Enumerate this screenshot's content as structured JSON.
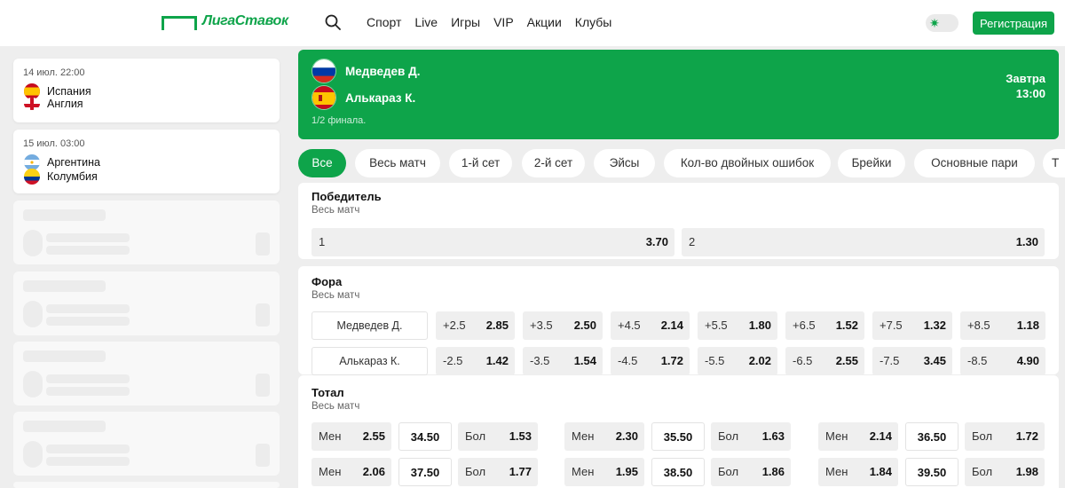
{
  "header": {
    "logo": "ЛигаСтавок",
    "nav": [
      "Спорт",
      "Live",
      "Игры",
      "VIP",
      "Акции",
      "Клубы"
    ],
    "register": "Регистрация"
  },
  "sidebar": {
    "matches": [
      {
        "date": "14 июл. 22:00",
        "team1": "Испания",
        "team2": "Англия"
      },
      {
        "date": "15 июл. 03:00",
        "team1": "Аргентина",
        "team2": "Колумбия"
      }
    ]
  },
  "event": {
    "player1": "Медведев Д.",
    "player2": "Алькараз К.",
    "round": "1/2 финала.",
    "day": "Завтра",
    "time": "13:00"
  },
  "filters": [
    "Все",
    "Весь матч",
    "1-й сет",
    "2-й сет",
    "Эйсы",
    "Кол-во двойных ошибок",
    "Брейки",
    "Основные пари",
    "Т"
  ],
  "winner": {
    "title": "Победитель",
    "subtitle": "Весь матч",
    "odds": [
      {
        "label": "1",
        "value": "3.70"
      },
      {
        "label": "2",
        "value": "1.30"
      }
    ]
  },
  "handicap": {
    "title": "Фора",
    "subtitle": "Весь матч",
    "rows": [
      {
        "name": "Медведев Д.",
        "odds": [
          {
            "line": "+2.5",
            "value": "2.85"
          },
          {
            "line": "+3.5",
            "value": "2.50"
          },
          {
            "line": "+4.5",
            "value": "2.14"
          },
          {
            "line": "+5.5",
            "value": "1.80"
          },
          {
            "line": "+6.5",
            "value": "1.52"
          },
          {
            "line": "+7.5",
            "value": "1.32"
          },
          {
            "line": "+8.5",
            "value": "1.18"
          }
        ]
      },
      {
        "name": "Алькараз К.",
        "odds": [
          {
            "line": "-2.5",
            "value": "1.42"
          },
          {
            "line": "-3.5",
            "value": "1.54"
          },
          {
            "line": "-4.5",
            "value": "1.72"
          },
          {
            "line": "-5.5",
            "value": "2.02"
          },
          {
            "line": "-6.5",
            "value": "2.55"
          },
          {
            "line": "-7.5",
            "value": "3.45"
          },
          {
            "line": "-8.5",
            "value": "4.90"
          }
        ]
      }
    ]
  },
  "total": {
    "title": "Тотал",
    "subtitle": "Весь матч",
    "rows": [
      [
        {
          "under": "2.55",
          "line": "34.50",
          "over": "1.53"
        },
        {
          "under": "2.30",
          "line": "35.50",
          "over": "1.63"
        },
        {
          "under": "2.14",
          "line": "36.50",
          "over": "1.72"
        }
      ],
      [
        {
          "under": "2.06",
          "line": "37.50",
          "over": "1.77"
        },
        {
          "under": "1.95",
          "line": "38.50",
          "over": "1.86"
        },
        {
          "under": "1.84",
          "line": "39.50",
          "over": "1.98"
        }
      ]
    ],
    "under_label": "Мен",
    "over_label": "Бол"
  }
}
